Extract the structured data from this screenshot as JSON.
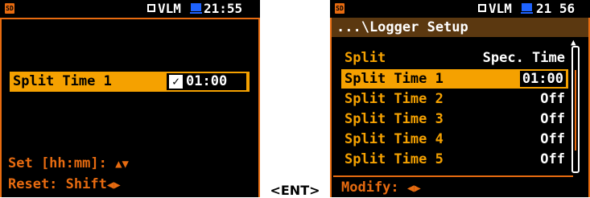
{
  "left_screen": {
    "status": {
      "sd_icon": "SD",
      "vlm": "VLM",
      "clock": "21:55",
      "battery_icon": "battery-icon"
    },
    "field": {
      "label": "Split Time 1",
      "value": "01:00",
      "checkbox_icon": "checkbox-checked-icon",
      "checkbox_glyph": "✓"
    },
    "hints": {
      "set_label": "Set [hh:mm]:",
      "set_arrows": "▲▼",
      "reset_label": "Reset: Shift",
      "reset_arrows": "◀▶"
    }
  },
  "right_screen": {
    "status": {
      "sd_icon": "SD",
      "vlm": "VLM",
      "clock": "21 56",
      "battery_icon": "battery-icon"
    },
    "title": "...\\Logger Setup",
    "rows": [
      {
        "label": "Split",
        "value": "Spec. Time"
      },
      {
        "label": "Split Time 1",
        "value": "01:00"
      },
      {
        "label": "Split Time 2",
        "value": "Off"
      },
      {
        "label": "Split Time 3",
        "value": "Off"
      },
      {
        "label": "Split Time 4",
        "value": "Off"
      },
      {
        "label": "Split Time 5",
        "value": "Off"
      }
    ],
    "selected_index": 1,
    "footer": {
      "label": "Modify:",
      "arrows": "◀▶"
    }
  },
  "between_label": "<ENT>",
  "colors": {
    "accent": "#e76b10",
    "highlight": "#f5a100",
    "title_bg": "#5b3810",
    "battery": "#1e63ff"
  }
}
